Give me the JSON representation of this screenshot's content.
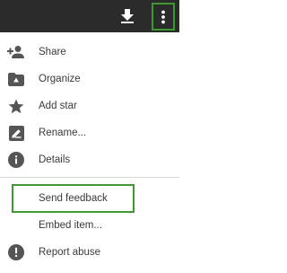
{
  "toolbar": {
    "download_icon": "download-icon",
    "more_icon": "more-vert-icon",
    "highlight_color": "#3c9a2e",
    "background_color": "#2b2b2b"
  },
  "menu": {
    "items": [
      {
        "label": "Share",
        "icon": "add-person-icon"
      },
      {
        "label": "Organize",
        "icon": "drive-folder-icon"
      },
      {
        "label": "Add star",
        "icon": "star-icon"
      },
      {
        "label": "Rename...",
        "icon": "edit-icon"
      },
      {
        "label": "Details",
        "icon": "info-icon"
      }
    ],
    "secondary_items": [
      {
        "label": "Send feedback"
      },
      {
        "label": "Embed item...",
        "highlighted": true
      },
      {
        "label": "Report abuse",
        "icon": "alert-icon"
      }
    ]
  }
}
